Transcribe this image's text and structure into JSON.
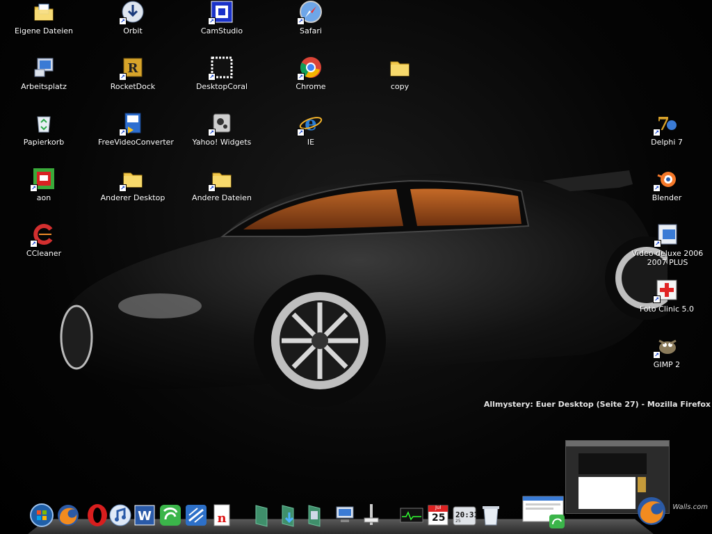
{
  "desktop": {
    "icons": [
      {
        "id": "eigene-dateien",
        "label": "Eigene Dateien",
        "icon": "folder-docs-icon"
      },
      {
        "id": "orbit",
        "label": "Orbit",
        "icon": "download-icon"
      },
      {
        "id": "camstudio",
        "label": "CamStudio",
        "icon": "camstudio-icon"
      },
      {
        "id": "safari",
        "label": "Safari",
        "icon": "safari-icon"
      },
      {
        "id": "arbeitsplatz",
        "label": "Arbeitsplatz",
        "icon": "computer-icon"
      },
      {
        "id": "rocketdock",
        "label": "RocketDock",
        "icon": "rocketdock-icon"
      },
      {
        "id": "desktopcoral",
        "label": "DesktopCoral",
        "icon": "desktopcoral-icon"
      },
      {
        "id": "chrome",
        "label": "Chrome",
        "icon": "chrome-icon"
      },
      {
        "id": "copy",
        "label": "copy",
        "icon": "folder-icon"
      },
      {
        "id": "papierkorb",
        "label": "Papierkorb",
        "icon": "recycle-bin-icon"
      },
      {
        "id": "freevideoconverter",
        "label": "FreeVideoConverter",
        "icon": "video-converter-icon"
      },
      {
        "id": "yahoo-widgets",
        "label": "Yahoo! Widgets",
        "icon": "widgets-icon"
      },
      {
        "id": "ie",
        "label": "IE",
        "icon": "ie-icon"
      },
      {
        "id": "delphi",
        "label": "Delphi 7",
        "icon": "delphi-icon"
      },
      {
        "id": "aon",
        "label": "aon",
        "icon": "aon-icon"
      },
      {
        "id": "anderer-desktop",
        "label": "Anderer Desktop",
        "icon": "folder-icon"
      },
      {
        "id": "andere-dateien",
        "label": "Andere Dateien",
        "icon": "folder-icon"
      },
      {
        "id": "blender",
        "label": "Blender",
        "icon": "blender-icon"
      },
      {
        "id": "ccleaner",
        "label": "CCleaner",
        "icon": "ccleaner-icon"
      },
      {
        "id": "video-deluxe",
        "label": "Video deluxe 2006 2007 PLUS",
        "icon": "video-deluxe-icon"
      },
      {
        "id": "foto-clinic",
        "label": "Foto Clinic 5.0",
        "icon": "foto-clinic-icon"
      },
      {
        "id": "gimp",
        "label": "GIMP 2",
        "icon": "gimp-icon"
      }
    ]
  },
  "window_title": "Allmystery: Euer Desktop (Seite 27) - Mozilla Firefox",
  "dock": {
    "items": [
      {
        "name": "start-orb-icon"
      },
      {
        "name": "firefox-icon"
      },
      {
        "name": "opera-icon"
      },
      {
        "name": "itunes-icon"
      },
      {
        "name": "word-icon"
      },
      {
        "name": "bittorrent-icon"
      },
      {
        "name": "ftp-icon"
      },
      {
        "name": "pdf-icon"
      },
      {
        "name": "stack-icon"
      },
      {
        "name": "downloads-stack-icon"
      },
      {
        "name": "pictures-stack-icon"
      },
      {
        "name": "network-icon"
      },
      {
        "name": "equalizer-icon"
      },
      {
        "name": "monitor-icon"
      },
      {
        "name": "calendar-icon",
        "month": "Jul",
        "day": "25"
      },
      {
        "name": "clock-icon",
        "time": "20:31",
        "sub": "25"
      },
      {
        "name": "recycle-bin-icon"
      },
      {
        "name": "screenshot-icon"
      },
      {
        "name": "firefox-icon"
      }
    ]
  },
  "watermark": "Walls.com"
}
